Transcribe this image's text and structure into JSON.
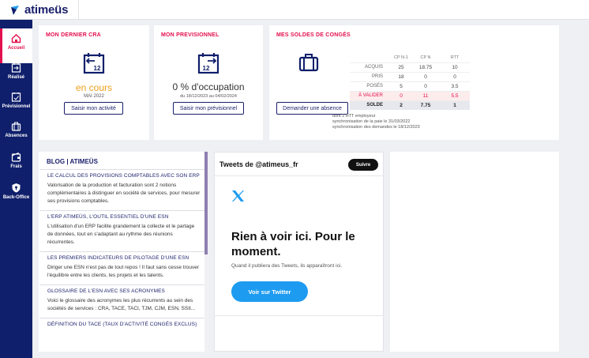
{
  "app": {
    "name": "atimeüs"
  },
  "sidebar": {
    "items": [
      {
        "label": "Accueil",
        "icon": "home-icon"
      },
      {
        "label": "Réalisé",
        "icon": "calendar-check-icon"
      },
      {
        "label": "Prévisionnel",
        "icon": "calendar-forward-icon"
      },
      {
        "label": "Absences",
        "icon": "suitcase-icon"
      },
      {
        "label": "Frais",
        "icon": "wallet-icon"
      },
      {
        "label": "Back-Office",
        "icon": "shield-icon"
      }
    ]
  },
  "cra": {
    "title": "MON DERNIER CRA",
    "icon_day": "12",
    "status": "en cours",
    "period": "MAI 2022",
    "button": "Saisir mon activité"
  },
  "previsionnel": {
    "title": "MON PREVISIONNEL",
    "icon_day": "12",
    "value": "0 % d'occupation",
    "period": "du 18/12/2023 au 04/02/2024",
    "button": "Saisir mon prévisionnel"
  },
  "soldes": {
    "title": "MES SOLDES DE CONGÉS",
    "button": "Demander une absence",
    "columns": [
      "CP N-1",
      "CP N",
      "RTT"
    ],
    "rows": [
      {
        "label": "ACQUIS",
        "values": [
          "25",
          "18.75",
          "10"
        ]
      },
      {
        "label": "PRIS",
        "values": [
          "18",
          "0",
          "0"
        ]
      },
      {
        "label": "POSÉS",
        "values": [
          "5",
          "0",
          "3.5"
        ]
      },
      {
        "label": "À VALIDER",
        "values": [
          "0",
          "11",
          "5.5"
        ]
      },
      {
        "label": "SOLDE",
        "values": [
          "2",
          "7.75",
          "1"
        ]
      }
    ],
    "notes": [
      "dont 2 RTT employeur",
      "synchronisation de la paie le 31/03/2022",
      "synchronisation des demandes le 18/12/2023"
    ]
  },
  "blog": {
    "title": "BLOG | ATIMEÜS",
    "items": [
      {
        "title": "LE CALCUL DES PROVISIONS COMPTABLES AVEC SON ERP",
        "text": "Valorisation de la production et facturation sont 2 notions complémentaires à distinguer en société de services, pour mesurer ses provisions comptables."
      },
      {
        "title": "L'ERP ATIMEÜS, L'OUTIL ESSENTIEL D'UNE ESN",
        "text": "L'utilisation d'un ERP facilite grandement la collecte et le partage de données, tout en s'adaptant au rythme des réunions récurrentes."
      },
      {
        "title": "LES PREMIERS INDICATEURS DE PILOTAGE D'UNE ESN",
        "text": "Diriger une ESN n'est pas de tout repos ! Il faut sans cesse trouver l'équilibre entre les clients, les projets et les talents."
      },
      {
        "title": "GLOSSAIRE DE L'ESN AVEC SES ACRONYMES",
        "text": "Voici le glossaire des acronymes les plus récurrents au sein des sociétés de services : CRA, TACE, TACI, TJM, CJM, ESN, SSII..."
      },
      {
        "title": "DÉFINITION DU TACE (TAUX D'ACTIVITÉ CONGÉS EXCLUS)",
        "text": ""
      }
    ]
  },
  "twitter": {
    "header": "Tweets de @atimeus_fr",
    "follow": "Suivre",
    "headline": "Rien à voir ici. Pour le moment.",
    "sub": "Quand il publiera des Tweets, ils apparaîtront ici.",
    "button": "Voir sur Twitter"
  },
  "colors": {
    "brand": "#101f6b",
    "accent": "#e3104e",
    "pending": "#f0a01e",
    "twitter": "#1d9bf0"
  }
}
